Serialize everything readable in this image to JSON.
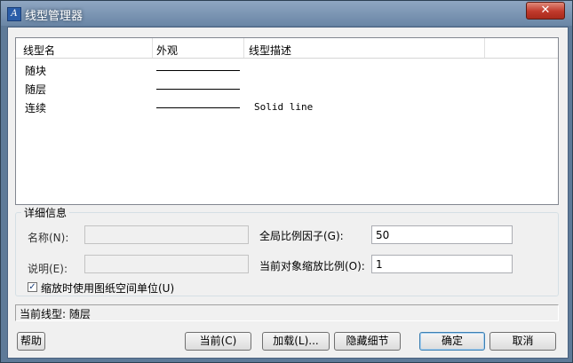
{
  "window": {
    "title": "线型管理器",
    "close_label": "✕"
  },
  "list": {
    "headers": [
      "线型名",
      "外观",
      "线型描述"
    ],
    "rows": [
      {
        "name": "随块",
        "desc": ""
      },
      {
        "name": "随层",
        "desc": ""
      },
      {
        "name": "连续",
        "desc": "Solid line"
      }
    ]
  },
  "details": {
    "group_title": "详细信息",
    "name_label": "名称(N):",
    "name_value": "",
    "desc_label": "说明(E):",
    "desc_value": "",
    "global_scale_label": "全局比例因子(G):",
    "global_scale_value": "50",
    "current_scale_label": "当前对象缩放比例(O):",
    "current_scale_value": "1",
    "paper_units_label": "缩放时使用图纸空间单位(U)",
    "paper_units_checked": true
  },
  "status": {
    "current_linetype": "当前线型: 随层"
  },
  "buttons": {
    "help": "帮助",
    "current": "当前(C)",
    "load": "加载(L)...",
    "hide_details": "隐藏细节",
    "ok": "确定",
    "cancel": "取消"
  }
}
